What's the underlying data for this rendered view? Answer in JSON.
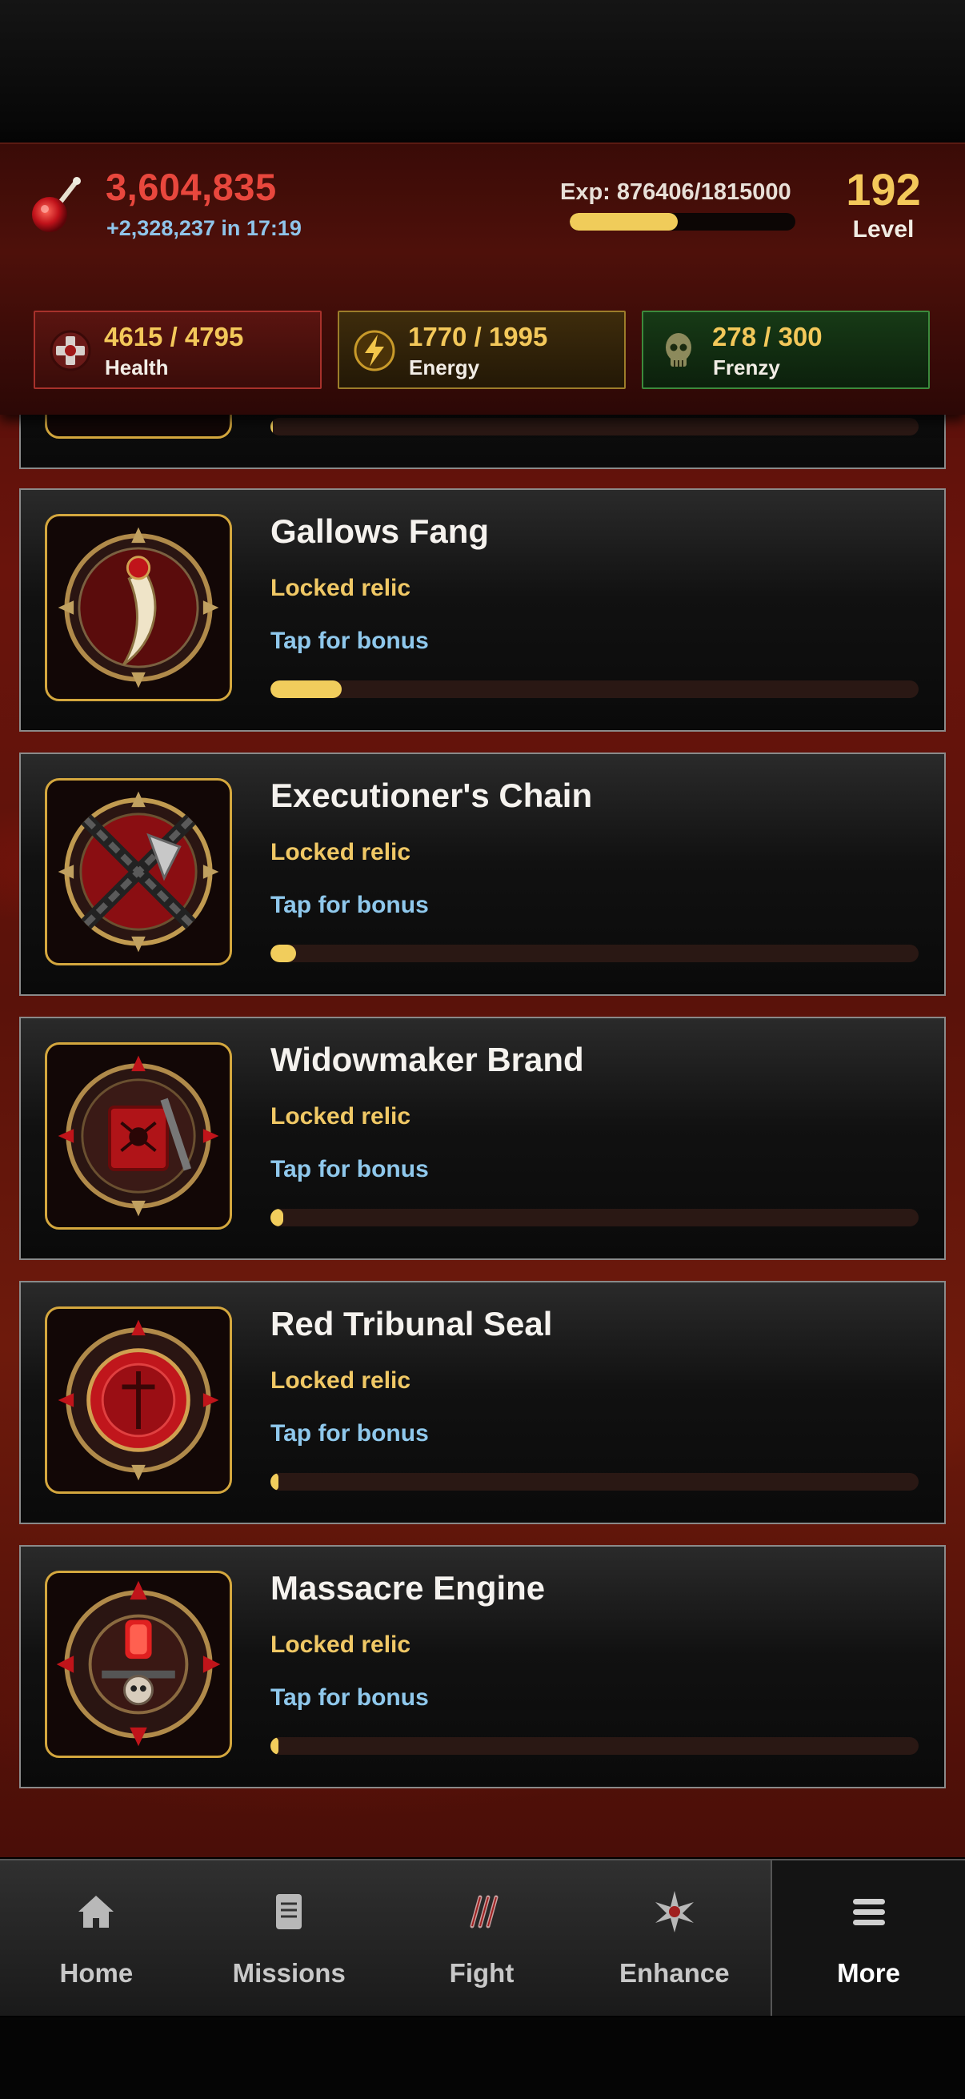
{
  "header": {
    "cash": "3,604,835",
    "cash_rate": "+2,328,237 in 17:19",
    "exp_label": "Exp: 876406/1815000",
    "exp_progress": 0.48,
    "level": "192",
    "level_label": "Level"
  },
  "stats": {
    "health": {
      "value": "4615 / 4795",
      "label": "Health"
    },
    "energy": {
      "value": "1770 / 1995",
      "label": "Energy"
    },
    "frenzy": {
      "value": "278 / 300",
      "label": "Frenzy"
    }
  },
  "relics": [
    {
      "name": "Gallows Fang",
      "status": "Locked relic",
      "action": "Tap for bonus",
      "progress": 0.11,
      "icon": "fang-relic-icon"
    },
    {
      "name": "Executioner's Chain",
      "status": "Locked relic",
      "action": "Tap for bonus",
      "progress": 0.04,
      "icon": "chain-axe-relic-icon"
    },
    {
      "name": "Widowmaker Brand",
      "status": "Locked relic",
      "action": "Tap for bonus",
      "progress": 0.02,
      "icon": "spider-brand-relic-icon"
    },
    {
      "name": "Red Tribunal Seal",
      "status": "Locked relic",
      "action": "Tap for bonus",
      "progress": 0.012,
      "icon": "seal-relic-icon"
    },
    {
      "name": "Massacre Engine",
      "status": "Locked relic",
      "action": "Tap for bonus",
      "progress": 0.006,
      "icon": "engine-relic-icon"
    }
  ],
  "nav": {
    "home": "Home",
    "missions": "Missions",
    "fight": "Fight",
    "enhance": "Enhance",
    "more": "More",
    "active": "more"
  },
  "colors": {
    "gold": "#f3c85a",
    "cash_red": "#e8473d",
    "link_blue": "#8fc8ec"
  }
}
